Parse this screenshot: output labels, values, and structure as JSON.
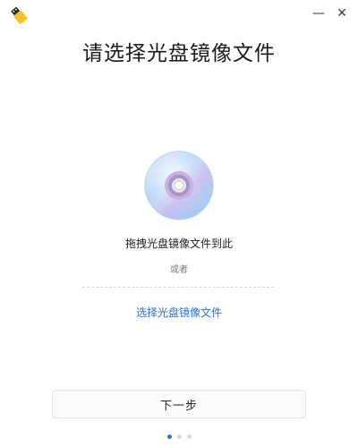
{
  "window": {
    "minimize_symbol": "—",
    "close_symbol": "✕"
  },
  "icons": {
    "app": "usb-drive-icon",
    "disc": "optical-disc-icon"
  },
  "main": {
    "title": "请选择光盘镜像文件",
    "drop_hint": "拖拽光盘镜像文件到此",
    "or_label": "或者",
    "select_link": "选择光盘镜像文件"
  },
  "footer": {
    "next_label": "下一步",
    "pagination": {
      "total": 3,
      "current": 1
    }
  },
  "colors": {
    "accent": "#2f6fd8",
    "dot_inactive": "#d9d9d9"
  }
}
